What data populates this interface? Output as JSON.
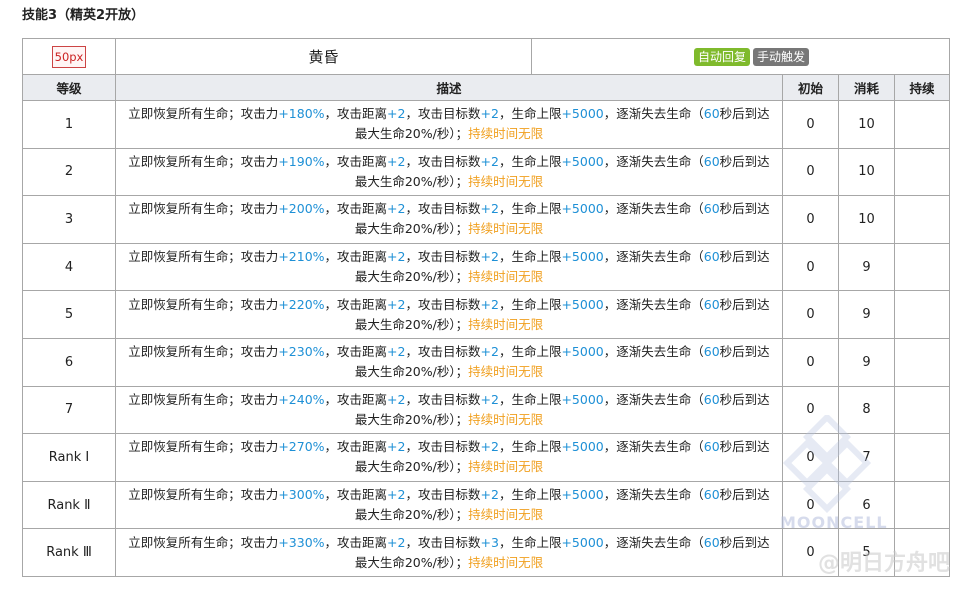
{
  "heading": "技能3（精英2开放）",
  "skill": {
    "icon_label": "50px",
    "name": "黄昏",
    "tags": [
      "自动回复",
      "手动触发"
    ]
  },
  "columns": [
    "等级",
    "描述",
    "初始",
    "消耗",
    "持续"
  ],
  "rows": [
    {
      "level": "1",
      "atk": "+180%",
      "range": "+2",
      "targets": "+2",
      "hp": "+5000",
      "secs": "60",
      "init": "0",
      "cost": "10",
      "duration": ""
    },
    {
      "level": "2",
      "atk": "+190%",
      "range": "+2",
      "targets": "+2",
      "hp": "+5000",
      "secs": "60",
      "init": "0",
      "cost": "10",
      "duration": ""
    },
    {
      "level": "3",
      "atk": "+200%",
      "range": "+2",
      "targets": "+2",
      "hp": "+5000",
      "secs": "60",
      "init": "0",
      "cost": "10",
      "duration": ""
    },
    {
      "level": "4",
      "atk": "+210%",
      "range": "+2",
      "targets": "+2",
      "hp": "+5000",
      "secs": "60",
      "init": "0",
      "cost": "9",
      "duration": ""
    },
    {
      "level": "5",
      "atk": "+220%",
      "range": "+2",
      "targets": "+2",
      "hp": "+5000",
      "secs": "60",
      "init": "0",
      "cost": "9",
      "duration": ""
    },
    {
      "level": "6",
      "atk": "+230%",
      "range": "+2",
      "targets": "+2",
      "hp": "+5000",
      "secs": "60",
      "init": "0",
      "cost": "9",
      "duration": ""
    },
    {
      "level": "7",
      "atk": "+240%",
      "range": "+2",
      "targets": "+2",
      "hp": "+5000",
      "secs": "60",
      "init": "0",
      "cost": "8",
      "duration": ""
    },
    {
      "level": "Rank Ⅰ",
      "atk": "+270%",
      "range": "+2",
      "targets": "+2",
      "hp": "+5000",
      "secs": "60",
      "init": "0",
      "cost": "7",
      "duration": ""
    },
    {
      "level": "Rank Ⅱ",
      "atk": "+300%",
      "range": "+2",
      "targets": "+2",
      "hp": "+5000",
      "secs": "60",
      "init": "0",
      "cost": "6",
      "duration": ""
    },
    {
      "level": "Rank Ⅲ",
      "atk": "+330%",
      "range": "+2",
      "targets": "+3",
      "hp": "+5000",
      "secs": "60",
      "init": "0",
      "cost": "5",
      "duration": ""
    }
  ],
  "desc_text": {
    "p1": "立即恢复所有生命；攻击力",
    "p2": "，攻击距离",
    "p3": "，攻击目标数",
    "p4": "，生命上限",
    "p5": "，逐渐失去生命（",
    "p6": "秒后到达",
    "p7": "最大生命20%/秒）；",
    "p8": "持续时间无限"
  },
  "watermark": {
    "logo_text": "MOONCELL",
    "site_text": "@明日方舟吧"
  },
  "colors": {
    "accent_blue": "#1e90d6",
    "accent_orange": "#f0a020",
    "tag_green": "#7fba2c",
    "tag_gray": "#777777",
    "header_bg": "#eaecf0"
  }
}
